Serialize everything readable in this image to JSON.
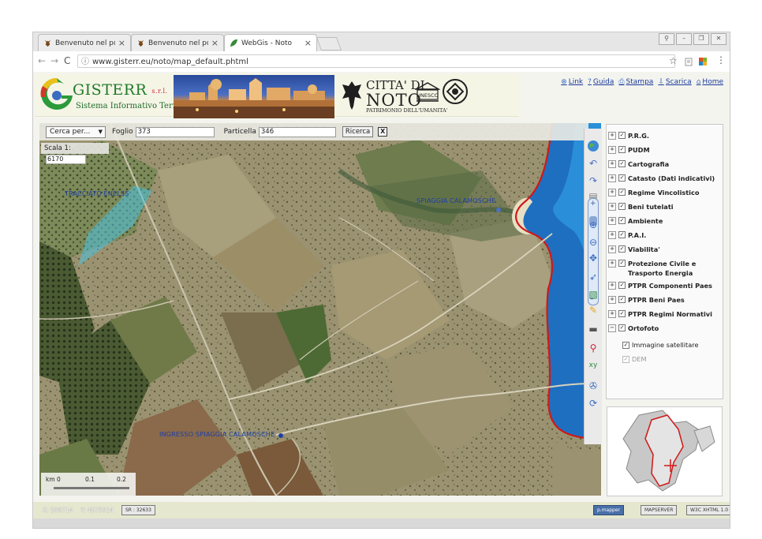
{
  "browser": {
    "tabs": [
      {
        "label": "Benvenuto nel portale is",
        "active": false
      },
      {
        "label": "Benvenuto nel portale is",
        "active": false
      },
      {
        "label": "WebGis - Noto",
        "active": true
      }
    ],
    "tab_close": "×",
    "url": "www.gisterr.eu/noto/map_default.phtml",
    "window_controls": [
      "⚲",
      "–",
      "❐",
      "✕"
    ]
  },
  "header": {
    "brand": "GISTERR",
    "brand_suffix": "s.r.l.",
    "brand_sub": "Sistema Informativo Territoriale",
    "city_line1": "CITTA' DI",
    "city_line2": "NOTO",
    "city_line3": "PATRIMONIO DELL'UMANITA'",
    "unesco": "UNESCO",
    "links": [
      {
        "label": "Link",
        "icon": "link-icon",
        "glyph": "⊗"
      },
      {
        "label": "Guida",
        "icon": "help-icon",
        "glyph": "?"
      },
      {
        "label": "Stampa",
        "icon": "print-icon",
        "glyph": "⎙"
      },
      {
        "label": "Scarica",
        "icon": "download-icon",
        "glyph": "⇩"
      },
      {
        "label": "Home",
        "icon": "home-icon",
        "glyph": "⌂"
      }
    ]
  },
  "search": {
    "select": "Cerca per...",
    "foglio_label": "Foglio",
    "foglio_value": "373",
    "particella_label": "Particella",
    "particella_value": "346",
    "button": "Ricerca",
    "close": "X"
  },
  "map": {
    "scale_label": "Scala 1:",
    "scale_value": "6170",
    "labels": [
      {
        "text": "TRACCIATO ENELSS",
        "name": "map-label-tracciato"
      },
      {
        "text": "SPIAGGIA CALAMOSCHE",
        "name": "map-label-spiaggia"
      },
      {
        "text": "INGRESSO SPIAGGIA CALAMOSCHE",
        "name": "map-label-ingresso"
      }
    ],
    "scalebar": {
      "unit": "km 0",
      "mid": "0.1",
      "end": "0.2"
    }
  },
  "layers": [
    {
      "label": "P.R.G."
    },
    {
      "label": "PUDM"
    },
    {
      "label": "Cartografia"
    },
    {
      "label": "Catasto (Dati indicativi)"
    },
    {
      "label": "Regime Vincolistico"
    },
    {
      "label": "Beni tutelati"
    },
    {
      "label": "Ambiente"
    },
    {
      "label": "P.A.I."
    },
    {
      "label": "Viabilita'"
    },
    {
      "label": "Protezione Civile e Trasporto Energia"
    },
    {
      "label": "PTPR Componenti Paes"
    },
    {
      "label": "PTPR Beni Paes"
    },
    {
      "label": "PTPR Regimi Normativi"
    },
    {
      "label": "Ortofoto",
      "expanded": true
    }
  ],
  "sublayers": [
    {
      "label": "Immagine satellitare",
      "active": true
    },
    {
      "label": "DEM",
      "active": false
    }
  ],
  "status": {
    "x_label": "X: 509714",
    "y_label": "Y: 4075014",
    "badge_sr": "SR : 32633",
    "badges": [
      "p.mapper",
      "MAPSERVER",
      "W3C XHTML 1.0"
    ]
  },
  "colors": {
    "brand_green": "#1f7a2a",
    "link_blue": "#1a3b9a",
    "map_label_blue": "#1c3ea6",
    "coast_red": "#d01818",
    "sea_blue": "#1f6fc0"
  }
}
